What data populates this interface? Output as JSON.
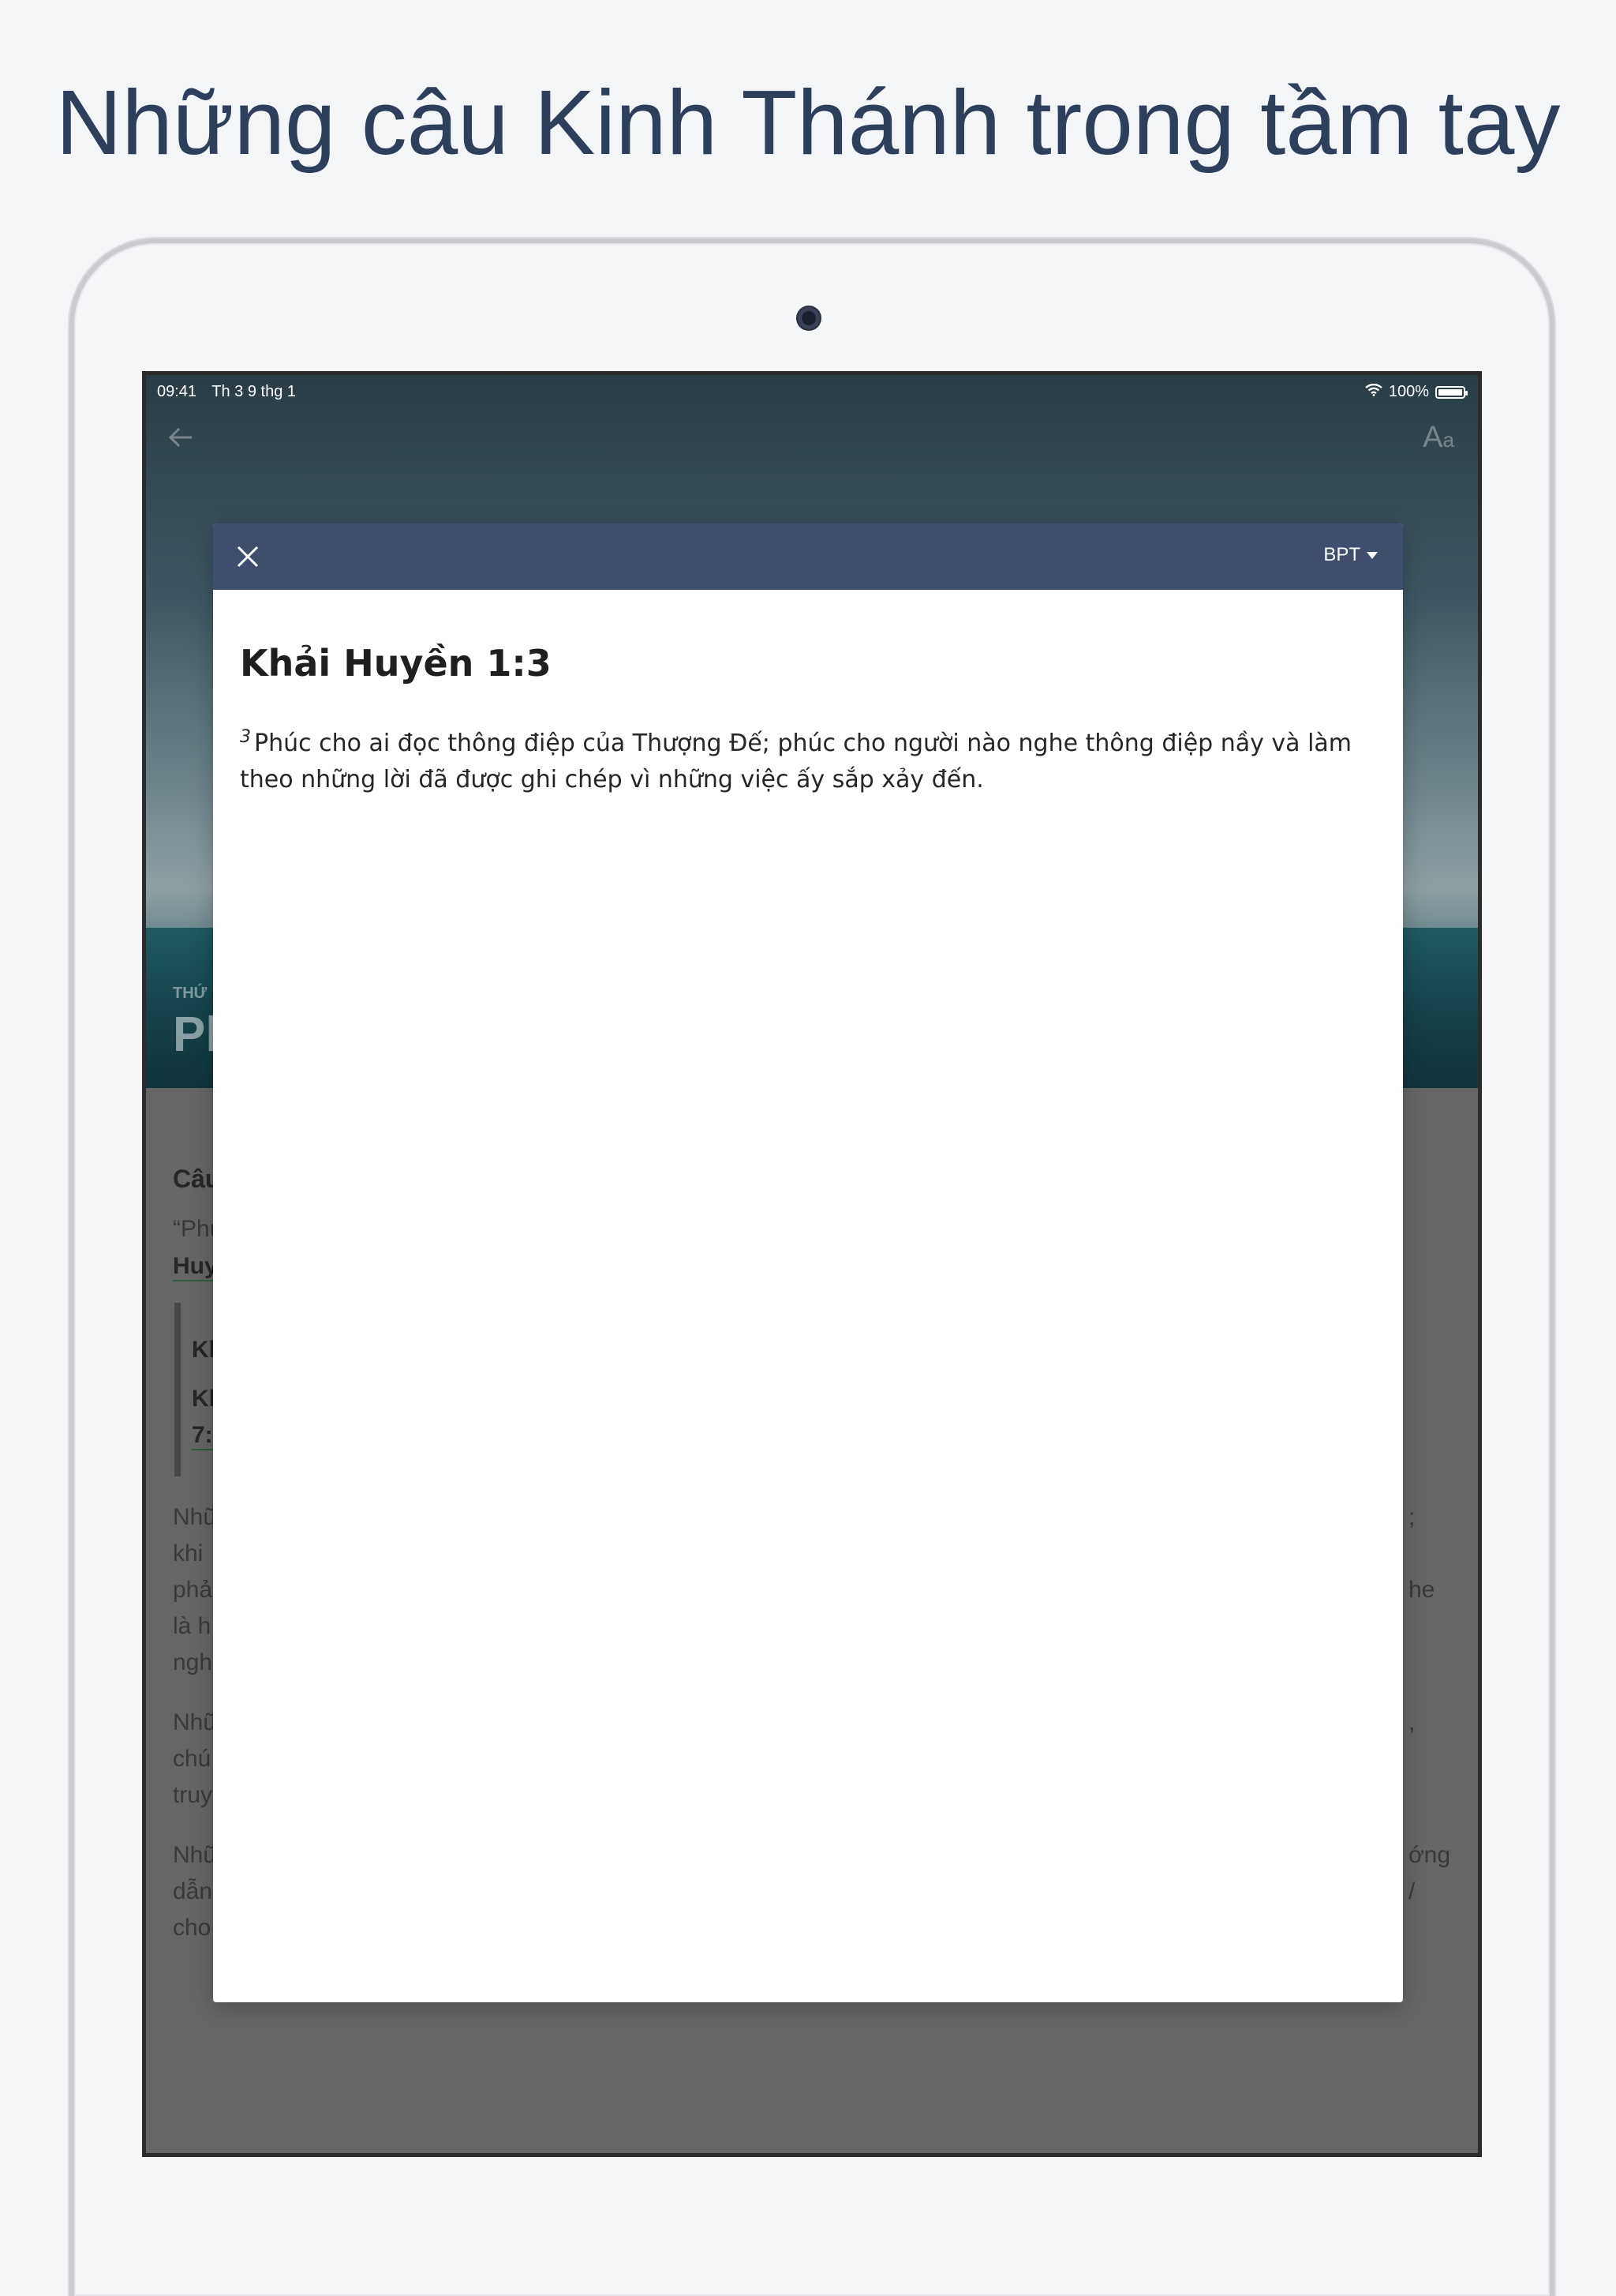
{
  "headline": "Những câu Kinh Thánh trong tầm tay",
  "status_bar": {
    "time": "09:41",
    "date": "Th 3 9 thg 1",
    "battery": "100%"
  },
  "nav": {
    "back_icon": "arrow-left-icon",
    "font_icon": "font-size-icon",
    "font_label_big": "A",
    "font_label_small": "a"
  },
  "hero": {
    "kicker": "THỨ",
    "title": "Ph"
  },
  "background_fragments": {
    "section_heading": "Câu",
    "quote_open": "“Phú",
    "link_ref": "Huyề",
    "quote_ref_1": "Kh",
    "quote_ref_2": "Kh",
    "quote_ref_3": "7:",
    "para1": [
      "Nhữ",
      "khi",
      "phả",
      "là h",
      "ngh"
    ],
    "para1_right": [
      ";",
      "he"
    ],
    "para2": [
      "Nhữ",
      "chú",
      "truy"
    ],
    "para2_right": [
      ","
    ],
    "para3": [
      "Nhữ",
      "dẫn",
      "cho"
    ],
    "para3_right": [
      "ớng",
      "/"
    ]
  },
  "modal": {
    "close_icon": "close-icon",
    "version": "BPT",
    "reference": "Khải Huyền 1:3",
    "verse_number": "3",
    "verse_text": "Phúc cho ai đọc thông điệp của Thượng Đế; phúc cho người nào nghe thông điệp nầy và làm theo những lời đã được ghi chép vì những việc ấy sắp xảy đến."
  },
  "colors": {
    "modal_header": "#3f4e6c",
    "headline": "#2d3f5a",
    "page_bg": "#f4f5f7",
    "dim_bg": "#666666"
  }
}
